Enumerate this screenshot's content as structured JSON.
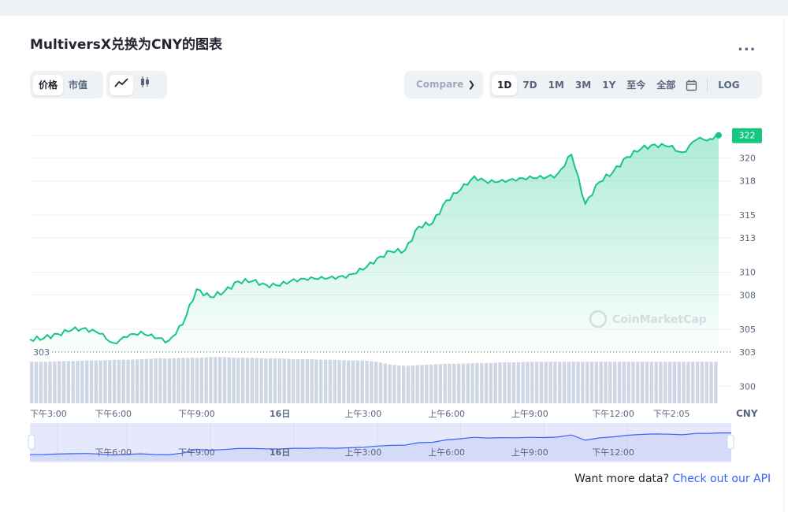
{
  "header": {
    "title": "MultiversX兑换为CNY的图表",
    "more_label": "..."
  },
  "toolbar": {
    "metric_tabs": [
      "价格",
      "市值"
    ],
    "chart_type_icons": [
      "line-chart-icon",
      "candlestick-icon"
    ],
    "compare_placeholder": "Compare",
    "ranges": [
      "1D",
      "7D",
      "1M",
      "3M",
      "1Y",
      "至今",
      "全部"
    ],
    "active_range": "1D",
    "calendar_icon": "calendar-icon",
    "log_label": "LOG"
  },
  "watermark": "CoinMarketCap",
  "footer": {
    "prompt": "Want more data?",
    "link": "Check out our API"
  },
  "colors": {
    "line": "#16c784",
    "volume": "#cfd6e4",
    "navigator_bg": "#e6e9fb",
    "navigator_line": "#3861fb",
    "link": "#3861fb"
  },
  "chart_data": {
    "type": "area",
    "currency_label": "CNY",
    "y_ticks": [
      300,
      303,
      305,
      308,
      310,
      313,
      315,
      318,
      320,
      322
    ],
    "ylim": [
      298.5,
      323.5
    ],
    "x_ticks": [
      "下午3:00",
      "下午6:00",
      "下午9:00",
      "16日",
      "上午3:00",
      "上午6:00",
      "上午9:00",
      "下午12:00",
      "下午2:05"
    ],
    "navigator_ticks": [
      "下午6:00",
      "下午9:00",
      "16日",
      "上午3:00",
      "上午6:00",
      "上午9:00",
      "下午12:00"
    ],
    "baseline_value": 303,
    "baseline_label": "303",
    "current_value": 322,
    "current_label": "322",
    "top_partial_label": "322",
    "x_hours": [
      0,
      0.5,
      1,
      1.5,
      2,
      2.5,
      3,
      3.5,
      4,
      4.5,
      5,
      5.5,
      6,
      6.5,
      7,
      7.5,
      8,
      8.5,
      9,
      9.5,
      10,
      10.5,
      11,
      11.5,
      12,
      12.5,
      13,
      13.5,
      14,
      14.5,
      15,
      15.5,
      16,
      16.5,
      17,
      17.5,
      18,
      18.5,
      19,
      19.5,
      20,
      20.5,
      21,
      21.5,
      22,
      22.5,
      23,
      23.5,
      24,
      24.5,
      24.8
    ],
    "price": [
      304.1,
      304.2,
      304.6,
      304.9,
      305.1,
      304.6,
      303.8,
      304.3,
      304.8,
      304.2,
      304.0,
      305.4,
      308.5,
      307.8,
      308.3,
      309.2,
      309.2,
      308.9,
      308.8,
      309.4,
      309.3,
      309.6,
      309.4,
      309.8,
      310.2,
      311.2,
      311.8,
      311.9,
      314.0,
      314.3,
      316.3,
      317.2,
      318.4,
      317.8,
      318.1,
      318.0,
      318.4,
      318.2,
      318.6,
      320.3,
      316.0,
      317.9,
      318.8,
      320.1,
      320.8,
      321.2,
      321.0,
      320.5,
      321.6,
      321.7,
      322.0
    ],
    "volume": [
      0.62,
      0.62,
      0.63,
      0.63,
      0.64,
      0.64,
      0.65,
      0.65,
      0.66,
      0.67,
      0.67,
      0.68,
      0.68,
      0.69,
      0.69,
      0.68,
      0.68,
      0.67,
      0.67,
      0.66,
      0.66,
      0.65,
      0.65,
      0.64,
      0.64,
      0.62,
      0.58,
      0.56,
      0.57,
      0.58,
      0.59,
      0.59,
      0.6,
      0.6,
      0.61,
      0.61,
      0.62,
      0.62,
      0.62,
      0.62,
      0.62,
      0.62,
      0.62,
      0.62,
      0.62,
      0.62,
      0.62,
      0.62,
      0.62,
      0.62,
      0.62
    ]
  }
}
